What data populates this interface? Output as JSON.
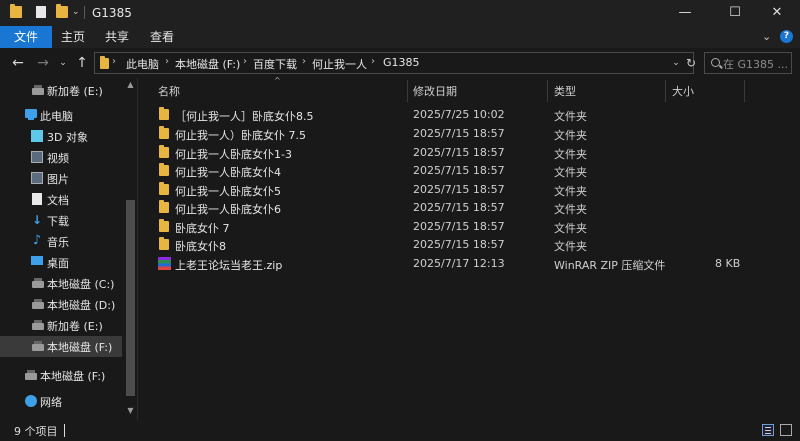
{
  "window": {
    "title": "G1385",
    "minimize": "—",
    "maximize": "☐",
    "close": "✕"
  },
  "ribbon": {
    "tabs": [
      "文件",
      "主页",
      "共享",
      "查看"
    ],
    "expand": "⌄",
    "help": "?"
  },
  "nav": {
    "back": "←",
    "forward": "→",
    "recent": "⌄",
    "up": "↑",
    "breadcrumbs": [
      "此电脑",
      "本地磁盘 (F:)",
      "百度下载",
      "何止我一人",
      "G1385"
    ],
    "chevron": "›",
    "refresh": "↻",
    "dropdown": "⌄"
  },
  "search": {
    "placeholder": "在 G1385 ..."
  },
  "sidebar": {
    "items": [
      {
        "label": "新加卷 (E:)",
        "icon": "drive-icon"
      },
      {
        "label": "此电脑",
        "icon": "pc-icon"
      },
      {
        "label": "3D 对象",
        "icon": "cube-icon"
      },
      {
        "label": "视频",
        "icon": "video-icon"
      },
      {
        "label": "图片",
        "icon": "picture-icon"
      },
      {
        "label": "文档",
        "icon": "document-icon"
      },
      {
        "label": "下载",
        "icon": "download-icon"
      },
      {
        "label": "音乐",
        "icon": "music-icon"
      },
      {
        "label": "桌面",
        "icon": "desktop-icon"
      },
      {
        "label": "本地磁盘 (C:)",
        "icon": "drive-icon"
      },
      {
        "label": "本地磁盘 (D:)",
        "icon": "drive-icon"
      },
      {
        "label": "新加卷 (E:)",
        "icon": "drive-icon"
      },
      {
        "label": "本地磁盘 (F:)",
        "icon": "drive-icon"
      },
      {
        "label": "本地磁盘 (F:)",
        "icon": "drive-icon"
      },
      {
        "label": "网络",
        "icon": "network-icon"
      }
    ]
  },
  "columns": {
    "name": "名称",
    "date": "修改日期",
    "type": "类型",
    "size": "大小"
  },
  "files": [
    {
      "name": "［何止我一人］卧底女仆8.5",
      "date": "2025/7/25 10:02",
      "type": "文件夹",
      "size": "",
      "icon": "folder-icon"
    },
    {
      "name": "何止我一人）卧底女仆 7.5",
      "date": "2025/7/15 18:57",
      "type": "文件夹",
      "size": "",
      "icon": "folder-icon"
    },
    {
      "name": "何止我一人卧底女仆1-3",
      "date": "2025/7/15 18:57",
      "type": "文件夹",
      "size": "",
      "icon": "folder-icon"
    },
    {
      "name": "何止我一人卧底女仆4",
      "date": "2025/7/15 18:57",
      "type": "文件夹",
      "size": "",
      "icon": "folder-icon"
    },
    {
      "name": "何止我一人卧底女仆5",
      "date": "2025/7/15 18:57",
      "type": "文件夹",
      "size": "",
      "icon": "folder-icon"
    },
    {
      "name": "何止我一人卧底女仆6",
      "date": "2025/7/15 18:57",
      "type": "文件夹",
      "size": "",
      "icon": "folder-icon"
    },
    {
      "name": "卧底女仆 7",
      "date": "2025/7/15 18:57",
      "type": "文件夹",
      "size": "",
      "icon": "folder-icon"
    },
    {
      "name": "卧底女仆8",
      "date": "2025/7/15 18:57",
      "type": "文件夹",
      "size": "",
      "icon": "folder-icon"
    },
    {
      "name": "上老王论坛当老王.zip",
      "date": "2025/7/17 12:13",
      "type": "WinRAR ZIP 压缩文件",
      "size": "8 KB",
      "icon": "winrar-zip-icon"
    }
  ],
  "status": {
    "count": "9 个项目"
  },
  "colors": {
    "accent": "#1976d2",
    "background": "#191919",
    "folder": "#e8b640"
  }
}
